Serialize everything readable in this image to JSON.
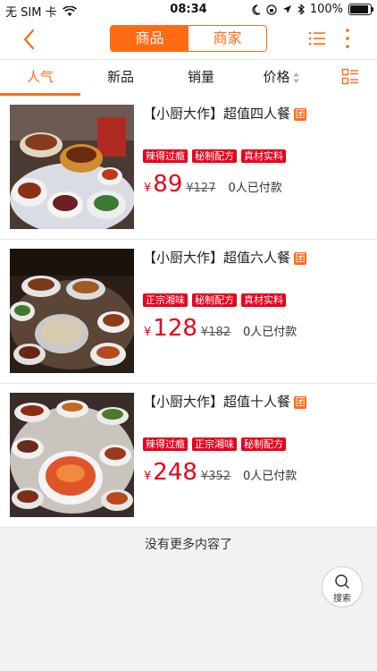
{
  "status_bar": {
    "carrier": "无 SIM 卡",
    "time": "08:34",
    "battery": "100%"
  },
  "header": {
    "segments": [
      {
        "label": "商品",
        "active": true
      },
      {
        "label": "商家",
        "active": false
      }
    ]
  },
  "tabs": [
    {
      "label": "人气",
      "active": true
    },
    {
      "label": "新品",
      "active": false
    },
    {
      "label": "销量",
      "active": false
    },
    {
      "label": "价格",
      "active": false
    }
  ],
  "items": [
    {
      "title": "【小厨大作】超值四人餐",
      "badge": "团",
      "tags": [
        "辣得过瘾",
        "秘制配方",
        "真材实料"
      ],
      "currency": "¥",
      "price": "89",
      "original_price": "¥127",
      "paid": "0人已付款"
    },
    {
      "title": "【小厨大作】超值六人餐",
      "badge": "团",
      "tags": [
        "正宗湘味",
        "秘制配方",
        "真材实料"
      ],
      "currency": "¥",
      "price": "128",
      "original_price": "¥182",
      "paid": "0人已付款"
    },
    {
      "title": "【小厨大作】超值十人餐",
      "badge": "团",
      "tags": [
        "辣得过瘾",
        "正宗湘味",
        "秘制配方"
      ],
      "currency": "¥",
      "price": "248",
      "original_price": "¥352",
      "paid": "0人已付款"
    }
  ],
  "footer": {
    "no_more": "没有更多内容了"
  },
  "search_fab": {
    "label": "搜索"
  },
  "colors": {
    "accent": "#ff6a14",
    "price_red": "#e8001c"
  },
  "icons": [
    "back-arrow-icon",
    "list-menu-icon",
    "more-vertical-icon",
    "sort-arrows-icon",
    "grid-list-toggle-icon",
    "search-icon",
    "wifi-icon",
    "moon-icon",
    "location-icon",
    "bluetooth-icon",
    "battery-icon"
  ]
}
